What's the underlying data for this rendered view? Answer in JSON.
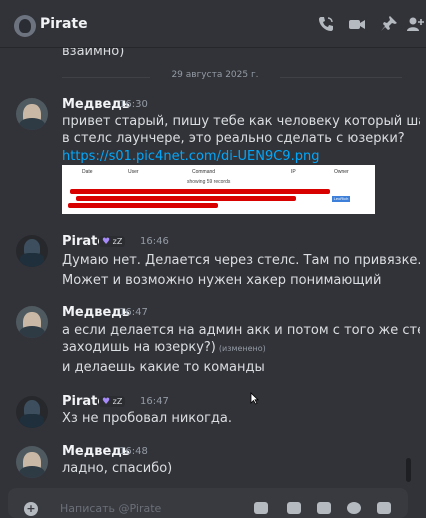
{
  "header": {
    "title": "Pirate"
  },
  "date_divider": "29 августа 2025 г.",
  "prev_message_tail": "взаимно)",
  "messages": [
    {
      "author": "Медведь",
      "time": "16:30",
      "lines": [
        "привет старый, пишу тебе как человеку который шарит",
        "в стелс лаунчере, это реально сделать с юзерки?"
      ],
      "link": "https://s01.pic4net.com/di-UEN9C9.png",
      "embed": {
        "columns": [
          "Date",
          "User",
          "Command",
          "IP",
          "Owner"
        ],
        "caption": "showing 59 records",
        "owner_value": "LeoRich"
      }
    },
    {
      "author": "Pirate",
      "time": "16:46",
      "badge_text": "zZ",
      "lines": [
        "Думаю нет. Делается через стелс. Там по привязке.",
        "Может и возможно нужен хакер понимающий"
      ]
    },
    {
      "author": "Медведь",
      "time": "16:47",
      "lines": [
        "а если делается на админ акк и потом с того же стелса",
        "заходишь на юзерку?)"
      ],
      "edited": "(изменено)",
      "extra_line": "и делаешь какие то команды"
    },
    {
      "author": "Pirate",
      "time": "16:47",
      "badge_text": "zZ",
      "lines": [
        "Хз не пробовал никогда."
      ]
    },
    {
      "author": "Медведь",
      "time": "16:48",
      "lines": [
        "ладно, спасибо)"
      ]
    }
  ],
  "composer": {
    "placeholder": "Написать @Pirate"
  },
  "colors": {
    "background": "#323339",
    "link": "#00a8fc",
    "accent_badge": "#a78bfa"
  }
}
